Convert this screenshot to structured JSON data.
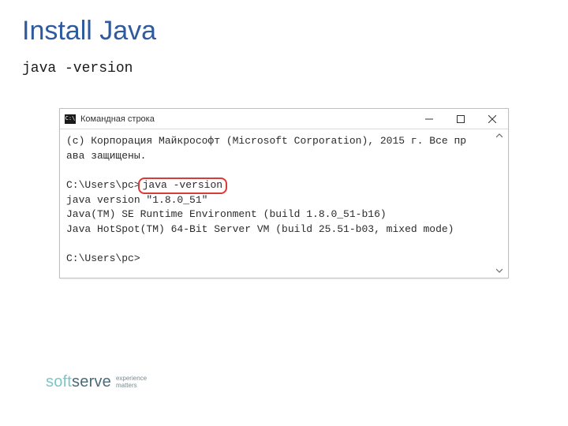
{
  "title": "Install Java",
  "subtitle": "java -version",
  "cmd": {
    "window_title": "Командная строка",
    "icon_text": "C:\\",
    "line1a": "(с) Корпорация Майкрософт (Microsoft Corporation), 2015 г. Все пр",
    "line1b": "ава защищены.",
    "prompt1_prefix": "C:\\Users\\pc>",
    "highlighted": "java -version",
    "out1": "java version \"1.8.0_51\"",
    "out2": "Java(TM) SE Runtime Environment (build 1.8.0_51-b16)",
    "out3": "Java HotSpot(TM) 64-Bit Server VM (build 25.51-b03, mixed mode)",
    "prompt2": "C:\\Users\\pc>"
  },
  "logo": {
    "soft": "soft",
    "serve": "serve",
    "tag1": "experience",
    "tag2": "matters"
  }
}
